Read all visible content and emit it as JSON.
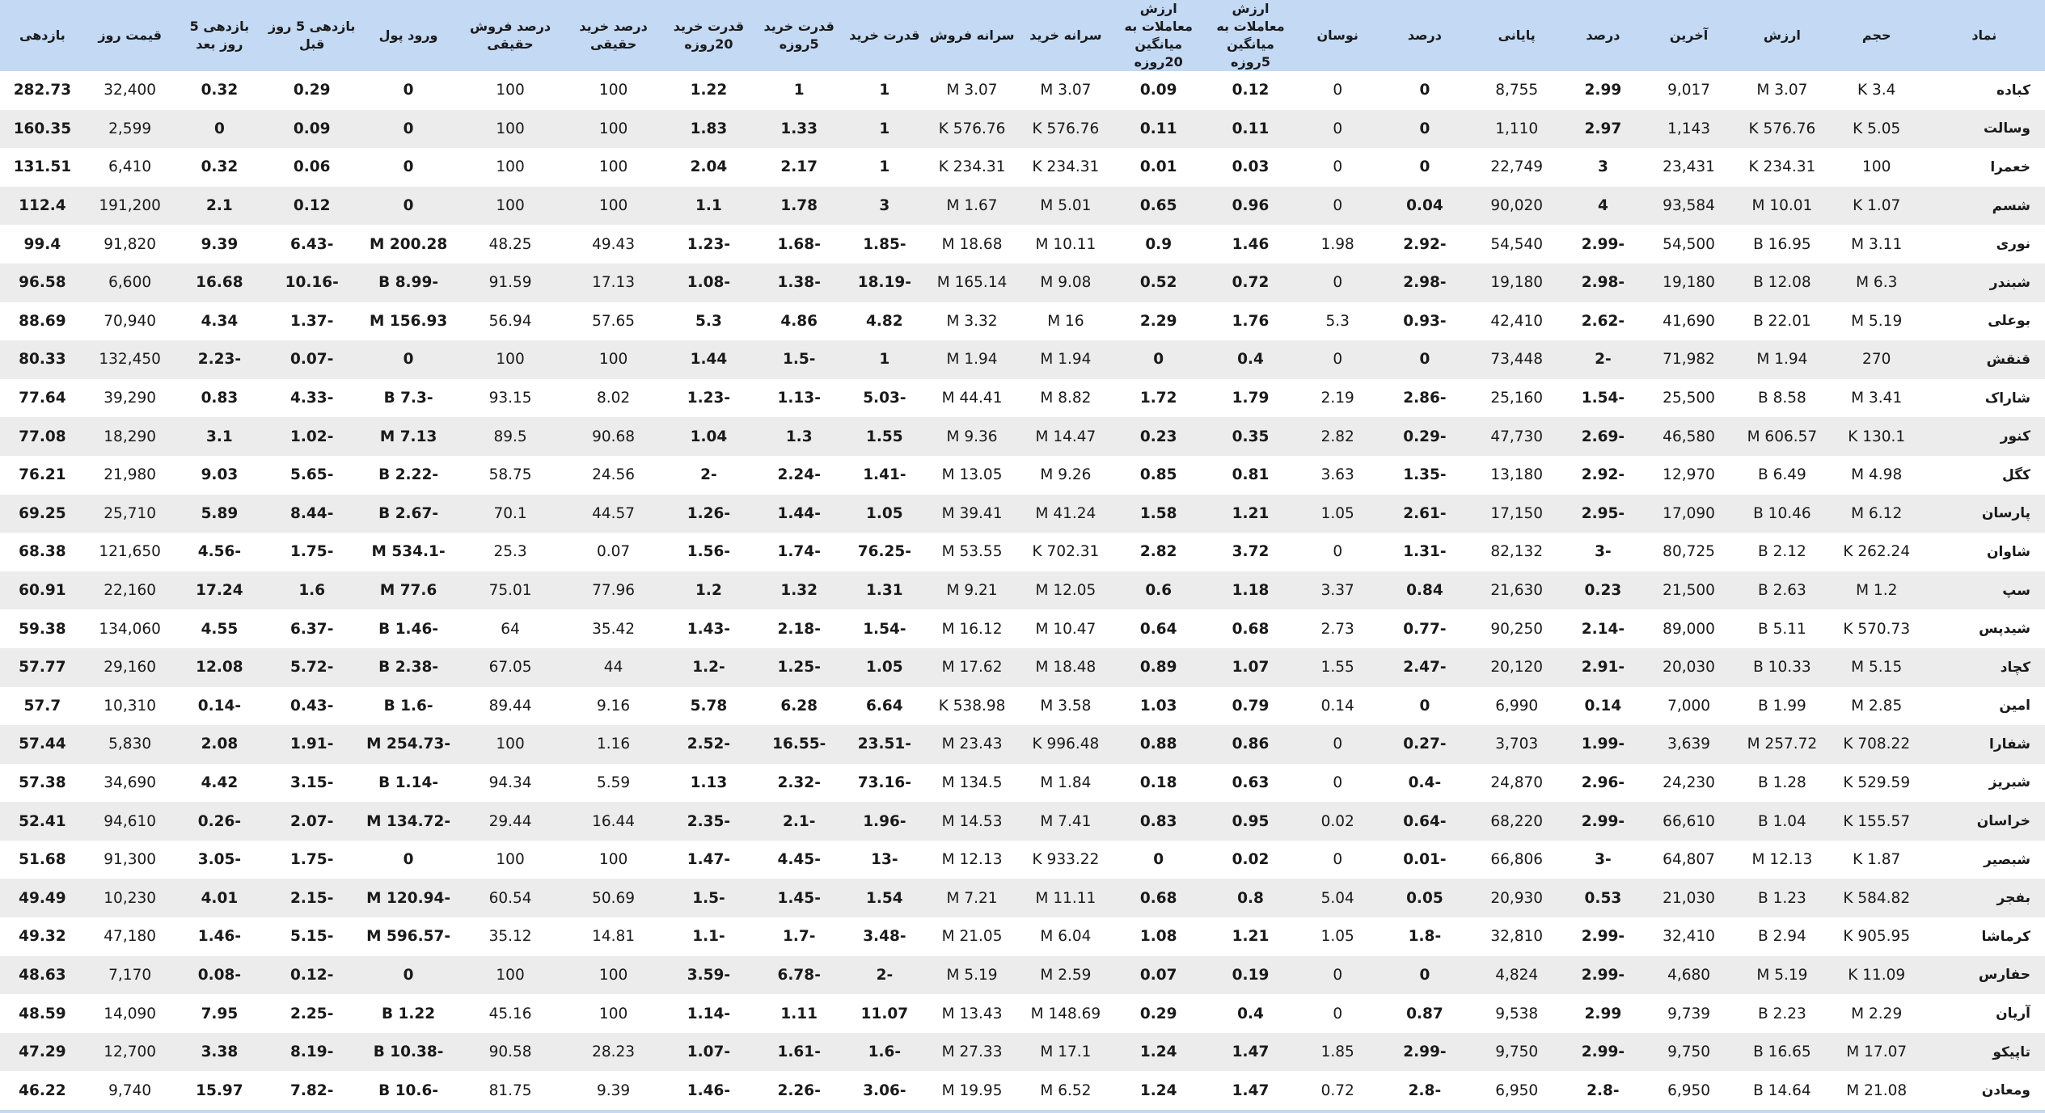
{
  "columns": [
    "نماد",
    "حجم",
    "ارزش",
    "آخرین",
    "درصد",
    "پایانی",
    "درصد",
    "نوسان",
    "ارزش معاملات به میانگین 5روزه",
    "ارزش معاملات به میانگین 20روزه",
    "سرانه خرید",
    "سرانه فروش",
    "قدرت خرید",
    "قدرت خرید 5روزه",
    "قدرت خرید 20روزه",
    "درصد خرید حقیقی",
    "درصد فروش حقیقی",
    "ورود پول",
    "بازدهی 5 روز قبل",
    "بازدهی 5 روز بعد",
    "قیمت روز",
    "بازدهی"
  ],
  "rows": [
    [
      "کباده",
      "3.4 K",
      "3.07 M",
      "9,017",
      "2.99",
      "8,755",
      "0",
      "0",
      "0.12",
      "0.09",
      "3.07 M",
      "3.07 M",
      "1",
      "1",
      "1.22",
      "100",
      "100",
      "0",
      "0.29",
      "0.32",
      "32,400",
      "282.73"
    ],
    [
      "وسالت",
      "5.05 K",
      "576.76 K",
      "1,143",
      "2.97",
      "1,110",
      "0",
      "0",
      "0.11",
      "0.11",
      "576.76 K",
      "576.76 K",
      "1",
      "1.33",
      "1.83",
      "100",
      "100",
      "0",
      "0.09",
      "0",
      "2,599",
      "160.35"
    ],
    [
      "خعمرا",
      "100",
      "234.31 K",
      "23,431",
      "3",
      "22,749",
      "0",
      "0",
      "0.03",
      "0.01",
      "234.31 K",
      "234.31 K",
      "1",
      "2.17",
      "2.04",
      "100",
      "100",
      "0",
      "0.06",
      "0.32",
      "6,410",
      "131.51"
    ],
    [
      "شسم",
      "1.07 K",
      "10.01 M",
      "93,584",
      "4",
      "90,020",
      "0.04",
      "0",
      "0.96",
      "0.65",
      "5.01 M",
      "1.67 M",
      "3",
      "1.78",
      "1.1",
      "100",
      "100",
      "0",
      "0.12",
      "2.1",
      "191,200",
      "112.4"
    ],
    [
      "نوری",
      "3.11 M",
      "16.95 B",
      "54,500",
      "-2.99",
      "54,540",
      "-2.92",
      "1.98",
      "1.46",
      "0.9",
      "10.11 M",
      "18.68 M",
      "-1.85",
      "-1.68",
      "-1.23",
      "49.43",
      "48.25",
      "200.28 M",
      "-6.43",
      "9.39",
      "91,820",
      "99.4"
    ],
    [
      "شبندر",
      "6.3 M",
      "12.08 B",
      "19,180",
      "-2.98",
      "19,180",
      "-2.98",
      "0",
      "0.72",
      "0.52",
      "9.08 M",
      "165.14 M",
      "-18.19",
      "-1.38",
      "-1.08",
      "17.13",
      "91.59",
      "-8.99 B",
      "-10.16",
      "16.68",
      "6,600",
      "96.58"
    ],
    [
      "بوعلی",
      "5.19 M",
      "22.01 B",
      "41,690",
      "-2.62",
      "42,410",
      "-0.93",
      "5.3",
      "1.76",
      "2.29",
      "16 M",
      "3.32 M",
      "4.82",
      "4.86",
      "5.3",
      "57.65",
      "56.94",
      "156.93 M",
      "-1.37",
      "4.34",
      "70,940",
      "88.69"
    ],
    [
      "قنقش",
      "270",
      "1.94 M",
      "71,982",
      "-2",
      "73,448",
      "0",
      "0",
      "0.4",
      "0",
      "1.94 M",
      "1.94 M",
      "1",
      "-1.5",
      "1.44",
      "100",
      "100",
      "0",
      "-0.07",
      "-2.23",
      "132,450",
      "80.33"
    ],
    [
      "شاراک",
      "3.41 M",
      "8.58 B",
      "25,500",
      "-1.54",
      "25,160",
      "-2.86",
      "2.19",
      "1.79",
      "1.72",
      "8.82 M",
      "44.41 M",
      "-5.03",
      "-1.13",
      "-1.23",
      "8.02",
      "93.15",
      "-7.3 B",
      "-4.33",
      "0.83",
      "39,290",
      "77.64"
    ],
    [
      "کنور",
      "130.1 K",
      "606.57 M",
      "46,580",
      "-2.69",
      "47,730",
      "-0.29",
      "2.82",
      "0.35",
      "0.23",
      "14.47 M",
      "9.36 M",
      "1.55",
      "1.3",
      "1.04",
      "90.68",
      "89.5",
      "7.13 M",
      "-1.02",
      "3.1",
      "18,290",
      "77.08"
    ],
    [
      "کگل",
      "4.98 M",
      "6.49 B",
      "12,970",
      "-2.92",
      "13,180",
      "-1.35",
      "3.63",
      "0.81",
      "0.85",
      "9.26 M",
      "13.05 M",
      "-1.41",
      "-2.24",
      "-2",
      "24.56",
      "58.75",
      "-2.22 B",
      "-5.65",
      "9.03",
      "21,980",
      "76.21"
    ],
    [
      "پارسان",
      "6.12 M",
      "10.46 B",
      "17,090",
      "-2.95",
      "17,150",
      "-2.61",
      "1.05",
      "1.21",
      "1.58",
      "41.24 M",
      "39.41 M",
      "1.05",
      "-1.44",
      "-1.26",
      "44.57",
      "70.1",
      "-2.67 B",
      "-8.44",
      "5.89",
      "25,710",
      "69.25"
    ],
    [
      "شاوان",
      "262.24 K",
      "2.12 B",
      "80,725",
      "-3",
      "82,132",
      "-1.31",
      "0",
      "3.72",
      "2.82",
      "702.31 K",
      "53.55 M",
      "-76.25",
      "-1.74",
      "-1.56",
      "0.07",
      "25.3",
      "-534.1 M",
      "-1.75",
      "-4.56",
      "121,650",
      "68.38"
    ],
    [
      "سپ",
      "1.2 M",
      "2.63 B",
      "21,500",
      "0.23",
      "21,630",
      "0.84",
      "3.37",
      "1.18",
      "0.6",
      "12.05 M",
      "9.21 M",
      "1.31",
      "1.32",
      "1.2",
      "77.96",
      "75.01",
      "77.6 M",
      "1.6",
      "17.24",
      "22,160",
      "60.91"
    ],
    [
      "شیدپس",
      "570.73 K",
      "5.11 B",
      "89,000",
      "-2.14",
      "90,250",
      "-0.77",
      "2.73",
      "0.68",
      "0.64",
      "10.47 M",
      "16.12 M",
      "-1.54",
      "-2.18",
      "-1.43",
      "35.42",
      "64",
      "-1.46 B",
      "-6.37",
      "4.55",
      "134,060",
      "59.38"
    ],
    [
      "کچاد",
      "5.15 M",
      "10.33 B",
      "20,030",
      "-2.91",
      "20,120",
      "-2.47",
      "1.55",
      "1.07",
      "0.89",
      "18.48 M",
      "17.62 M",
      "1.05",
      "-1.25",
      "-1.2",
      "44",
      "67.05",
      "-2.38 B",
      "-5.72",
      "12.08",
      "29,160",
      "57.77"
    ],
    [
      "امین",
      "2.85 M",
      "1.99 B",
      "7,000",
      "0.14",
      "6,990",
      "0",
      "0.14",
      "0.79",
      "1.03",
      "3.58 M",
      "538.98 K",
      "6.64",
      "6.28",
      "5.78",
      "9.16",
      "89.44",
      "-1.6 B",
      "-0.43",
      "-0.14",
      "10,310",
      "57.7"
    ],
    [
      "شفارا",
      "708.22 K",
      "257.72 M",
      "3,639",
      "-1.99",
      "3,703",
      "-0.27",
      "0",
      "0.86",
      "0.88",
      "996.48 K",
      "23.43 M",
      "-23.51",
      "-16.55",
      "-2.52",
      "1.16",
      "100",
      "-254.73 M",
      "-1.91",
      "2.08",
      "5,830",
      "57.44"
    ],
    [
      "شبریز",
      "529.59 K",
      "1.28 B",
      "24,230",
      "-2.96",
      "24,870",
      "-0.4",
      "0",
      "0.63",
      "0.18",
      "1.84 M",
      "134.5 M",
      "-73.16",
      "-2.32",
      "1.13",
      "5.59",
      "94.34",
      "-1.14 B",
      "-3.15",
      "4.42",
      "34,690",
      "57.38"
    ],
    [
      "خراسان",
      "155.57 K",
      "1.04 B",
      "66,610",
      "-2.99",
      "68,220",
      "-0.64",
      "0.02",
      "0.95",
      "0.83",
      "7.41 M",
      "14.53 M",
      "-1.96",
      "-2.1",
      "-2.35",
      "16.44",
      "29.44",
      "-134.72 M",
      "-2.07",
      "-0.26",
      "94,610",
      "52.41"
    ],
    [
      "شبصیر",
      "1.87 K",
      "12.13 M",
      "64,807",
      "-3",
      "66,806",
      "-0.01",
      "0",
      "0.02",
      "0",
      "933.22 K",
      "12.13 M",
      "-13",
      "-4.45",
      "-1.47",
      "100",
      "100",
      "0",
      "-1.75",
      "-3.05",
      "91,300",
      "51.68"
    ],
    [
      "بفجر",
      "584.82 K",
      "1.23 B",
      "21,030",
      "0.53",
      "20,930",
      "0.05",
      "5.04",
      "0.8",
      "0.68",
      "11.11 M",
      "7.21 M",
      "1.54",
      "-1.45",
      "-1.5",
      "50.69",
      "60.54",
      "-120.94 M",
      "-2.15",
      "4.01",
      "10,230",
      "49.49"
    ],
    [
      "کرماشا",
      "905.95 K",
      "2.94 B",
      "32,410",
      "-2.99",
      "32,810",
      "-1.8",
      "1.05",
      "1.21",
      "1.08",
      "6.04 M",
      "21.05 M",
      "-3.48",
      "-1.7",
      "-1.1",
      "14.81",
      "35.12",
      "-596.57 M",
      "-5.15",
      "-1.46",
      "47,180",
      "49.32"
    ],
    [
      "حفارس",
      "11.09 K",
      "5.19 M",
      "4,680",
      "-2.99",
      "4,824",
      "0",
      "0",
      "0.19",
      "0.07",
      "2.59 M",
      "5.19 M",
      "-2",
      "-6.78",
      "-3.59",
      "100",
      "100",
      "0",
      "-0.12",
      "-0.08",
      "7,170",
      "48.63"
    ],
    [
      "آریان",
      "2.29 M",
      "2.23 B",
      "9,739",
      "2.99",
      "9,538",
      "0.87",
      "0",
      "0.4",
      "0.29",
      "148.69 M",
      "13.43 M",
      "11.07",
      "1.11",
      "-1.14",
      "100",
      "45.16",
      "1.22 B",
      "-2.25",
      "7.95",
      "14,090",
      "48.59"
    ],
    [
      "تاپیکو",
      "17.07 M",
      "16.65 B",
      "9,750",
      "-2.99",
      "9,750",
      "-2.99",
      "1.85",
      "1.47",
      "1.24",
      "17.1 M",
      "27.33 M",
      "-1.6",
      "-1.61",
      "-1.07",
      "28.23",
      "90.58",
      "-10.38 B",
      "-8.19",
      "3.38",
      "12,700",
      "47.29"
    ],
    [
      "ومعادن",
      "21.08 M",
      "14.64 B",
      "6,950",
      "-2.8",
      "6,950",
      "-2.8",
      "0.72",
      "1.47",
      "1.24",
      "6.52 M",
      "19.95 M",
      "-3.06",
      "-2.26",
      "-1.46",
      "9.39",
      "81.75",
      "-10.6 B",
      "-7.82",
      "15.97",
      "9,740",
      "46.22"
    ]
  ],
  "colors": {
    "header_bg": "#c3d9f4",
    "row_alt_bg": "#ececec",
    "positive": "#1e7a1e",
    "negative": "#e0141e"
  }
}
